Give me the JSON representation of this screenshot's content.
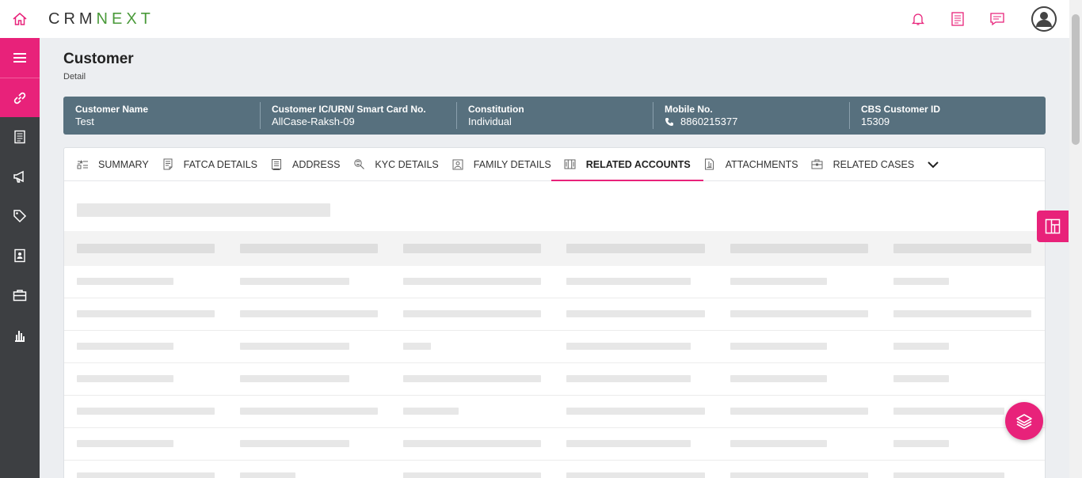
{
  "brand": {
    "logo_crm": "CRM",
    "logo_next": "NEXT"
  },
  "topbar": {
    "icons": [
      "home-icon",
      "bell-icon",
      "notes-icon",
      "chat-icon",
      "user-icon"
    ]
  },
  "sidebar": {
    "items": [
      "menu-icon",
      "link-icon",
      "document-icon",
      "megaphone-icon",
      "tag-icon",
      "contact-book-icon",
      "briefcase-icon",
      "bar-chart-icon"
    ]
  },
  "page": {
    "title": "Customer",
    "subtitle": "Detail"
  },
  "banner": [
    {
      "label": "Customer Name",
      "value": "Test"
    },
    {
      "label": "Customer IC/URN/ Smart Card No.",
      "value": "AllCase-Raksh-09"
    },
    {
      "label": "Constitution",
      "value": "Individual"
    },
    {
      "label": "Mobile No.",
      "value": "8860215377",
      "icon": "phone-icon"
    },
    {
      "label": "CBS Customer ID",
      "value": "15309"
    }
  ],
  "tabs": [
    {
      "label": "SUMMARY",
      "icon": "summary-icon"
    },
    {
      "label": "FATCA DETAILS",
      "icon": "fatca-icon"
    },
    {
      "label": "ADDRESS",
      "icon": "address-icon"
    },
    {
      "label": "KYC DETAILS",
      "icon": "kyc-icon"
    },
    {
      "label": "FAMILY DETAILS",
      "icon": "family-icon"
    },
    {
      "label": "RELATED ACCOUNTS",
      "icon": "accounts-icon",
      "active": true
    },
    {
      "label": "ATTACHMENTS",
      "icon": "attachments-icon"
    },
    {
      "label": "RELATED CASES",
      "icon": "cases-icon"
    }
  ],
  "colors": {
    "accent": "#e8227a",
    "sidebar": "#3d3f42",
    "banner": "#57707e",
    "brand_green": "#4a9a3a"
  }
}
